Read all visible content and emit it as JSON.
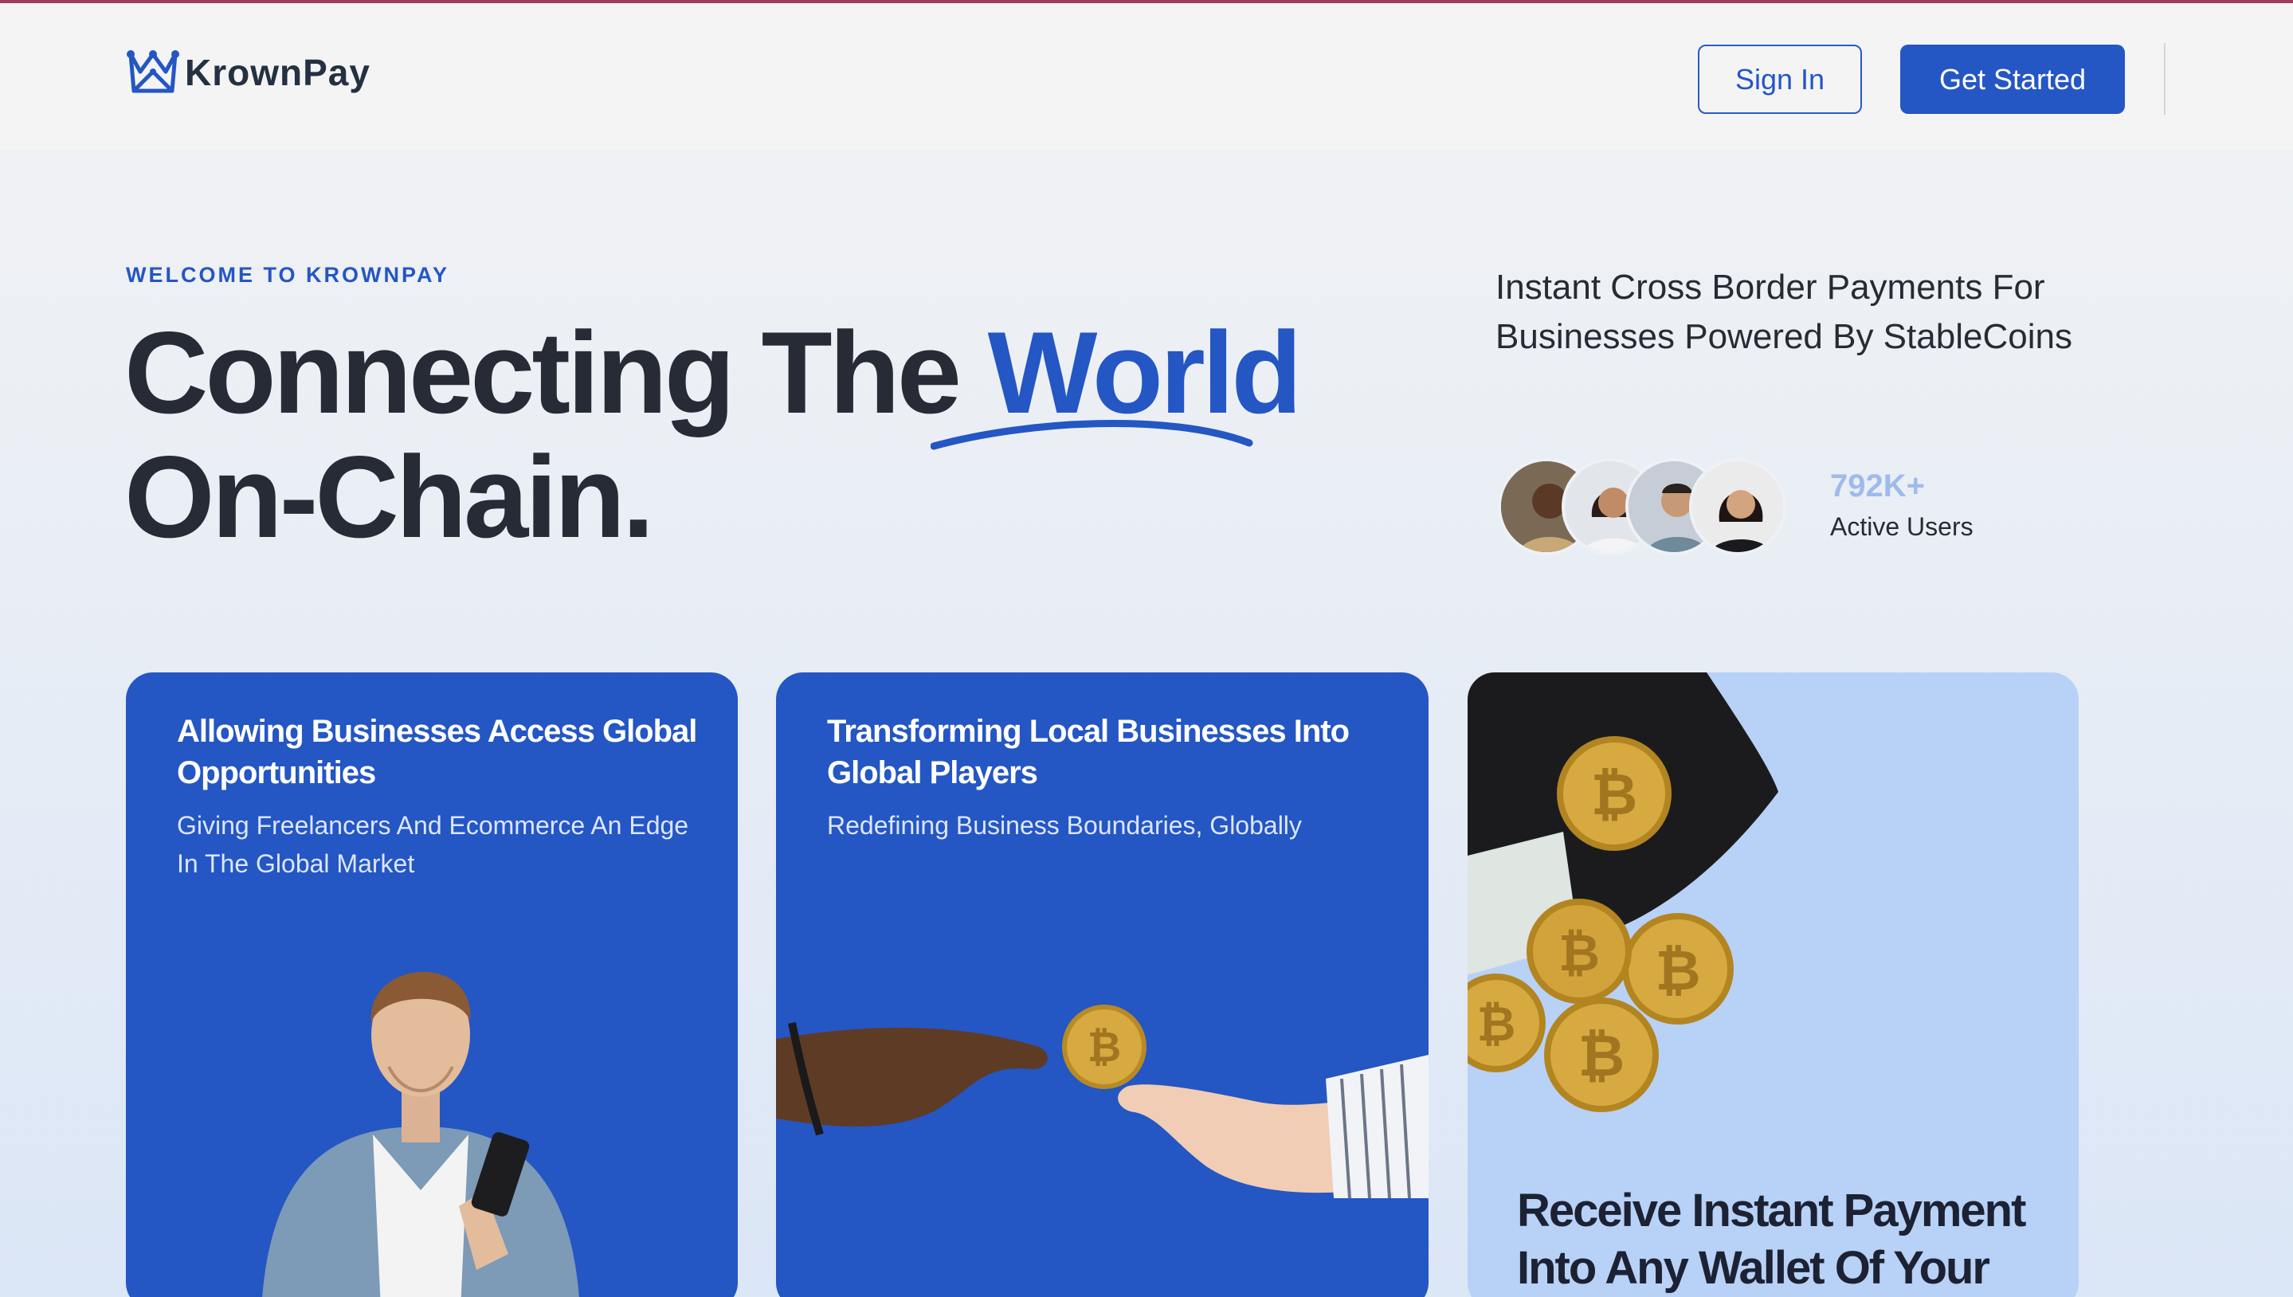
{
  "header": {
    "brand": "KrownPay",
    "sign_in_label": "Sign In",
    "get_started_label": "Get Started"
  },
  "hero": {
    "eyebrow": "WELCOME TO KROWNPAY",
    "headline_part1": "Connecting The ",
    "headline_accent": "World",
    "headline_part2": "On-Chain.",
    "subtitle": "Instant Cross Border Payments For Businesses Powered By StableCoins",
    "stat_value": "792K+",
    "stat_label": "Active Users"
  },
  "cards": [
    {
      "title": "Allowing Businesses Access Global Opportunities",
      "subtitle": "Giving Freelancers And Ecommerce An Edge In The Global Market"
    },
    {
      "title": "Transforming Local Businesses Into Global Players",
      "subtitle": "Redefining Business Boundaries, Globally"
    },
    {
      "title": "Receive Instant Payment Into Any Wallet Of Your"
    }
  ],
  "colors": {
    "brand_blue": "#2456c4",
    "light_blue": "#b8d1f6",
    "text_dark": "#272b35",
    "top_accent": "#a23b5a"
  },
  "icons": {
    "logo": "krownpay-crown-logo-icon"
  }
}
